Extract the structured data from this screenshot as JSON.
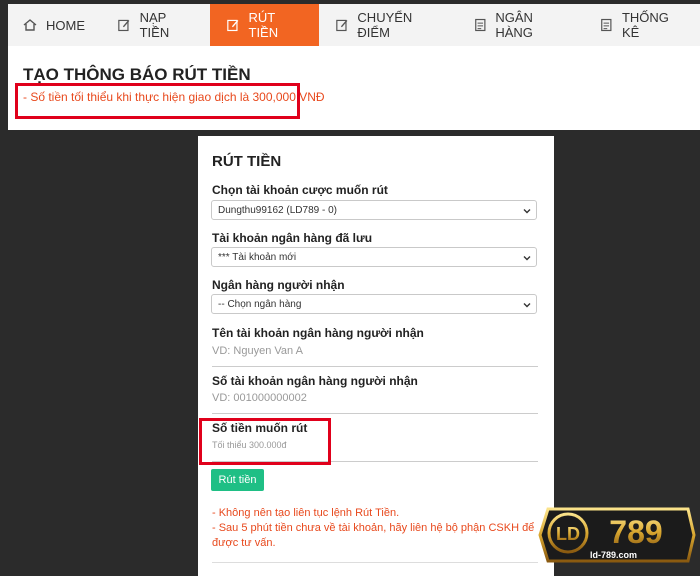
{
  "nav": {
    "items": [
      {
        "label": "HOME",
        "icon": "home-icon"
      },
      {
        "label": "NẠP TIỀN",
        "icon": "edit-icon"
      },
      {
        "label": "RÚT TIỀN",
        "icon": "edit-icon",
        "active": true
      },
      {
        "label": "CHUYỂN ĐIỂM",
        "icon": "edit-icon"
      },
      {
        "label": "NGÂN HÀNG",
        "icon": "document-icon"
      },
      {
        "label": "THỐNG KÊ",
        "icon": "document-icon"
      }
    ]
  },
  "notice": {
    "title": "TẠO THÔNG BÁO RÚT TIỀN",
    "text": "- Số tiền tối thiểu khi thực hiện giao dịch là 300,000 VNĐ"
  },
  "form": {
    "title": "RÚT TIỀN",
    "account_label": "Chọn tài khoản cược muốn rút",
    "account_value": "Dungthu99162 (LD789 - 0)",
    "saved_bank_label": "Tài khoản ngân hàng đã lưu",
    "saved_bank_value": "*** Tài khoản mới",
    "receiver_bank_label": "Ngân hàng người nhận",
    "receiver_bank_value": "-- Chọn ngân hàng",
    "account_name_label": "Tên tài khoản ngân hàng người nhận",
    "account_name_placeholder": "VD: Nguyen Van A",
    "account_number_label": "Số tài khoản ngân hàng người nhận",
    "account_number_placeholder": "VD: 001000000002",
    "amount_label": "Số tiền muốn rút",
    "amount_placeholder": "Tối thiểu 300.000đ",
    "submit_label": "Rút tiền",
    "notes": [
      "- Không nên tạo liên tục lệnh Rút Tiền.",
      "- Sau 5 phút tiền chưa về tài khoản, hãy liên hệ bộ phận CSKH để được tư vấn."
    ]
  },
  "logo": {
    "text": "LD789",
    "url": "ld-789.com"
  },
  "colors": {
    "accent": "#f26522",
    "warning_text": "#e8491d",
    "button": "#1fbf85",
    "highlight_box": "#e0001b"
  }
}
